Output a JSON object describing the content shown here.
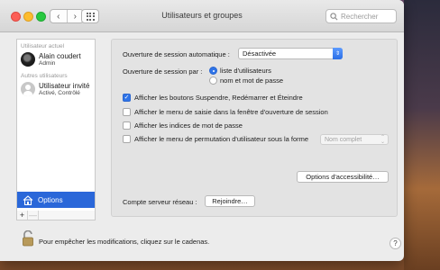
{
  "window": {
    "title": "Utilisateurs et groupes",
    "search_placeholder": "Rechercher"
  },
  "sidebar": {
    "section_current": "Utilisateur actuel",
    "current_user": {
      "name": "Alain coudert",
      "role": "Admin"
    },
    "section_other": "Autres utilisateurs",
    "guest_user": {
      "name": "Utilisateur invité",
      "status": "Activé, Contrôlé"
    },
    "options_label": "Options",
    "add_label": "+",
    "remove_label": "—"
  },
  "login_options": {
    "auto_login_label": "Ouverture de session automatique :",
    "auto_login_value": "Désactivée",
    "login_by_label": "Ouverture de session par :",
    "radio_options": [
      {
        "label": "liste d'utilisateurs",
        "selected": true
      },
      {
        "label": "nom et mot de passe",
        "selected": false
      }
    ],
    "checkboxes": [
      {
        "label": "Afficher les boutons Suspendre, Redémarrer et Éteindre",
        "checked": true
      },
      {
        "label": "Afficher le menu de saisie dans la fenêtre d'ouverture de session",
        "checked": false
      },
      {
        "label": "Afficher les indices de mot de passe",
        "checked": false
      },
      {
        "label": "Afficher le menu de permutation d'utilisateur sous la forme",
        "checked": false
      }
    ],
    "switch_format_value": "Nom complet",
    "accessibility_button": "Options d'accessibilité…",
    "network_server_label": "Compte serveur réseau :",
    "join_button": "Rejoindre…"
  },
  "footer": {
    "lock_text": "Pour empêcher les modifications, cliquez sur le cadenas.",
    "help_label": "?"
  },
  "colors": {
    "accent": "#2a67d9",
    "close": "#fc5f57",
    "minimize": "#fdbc2e",
    "maximize": "#28c840"
  }
}
